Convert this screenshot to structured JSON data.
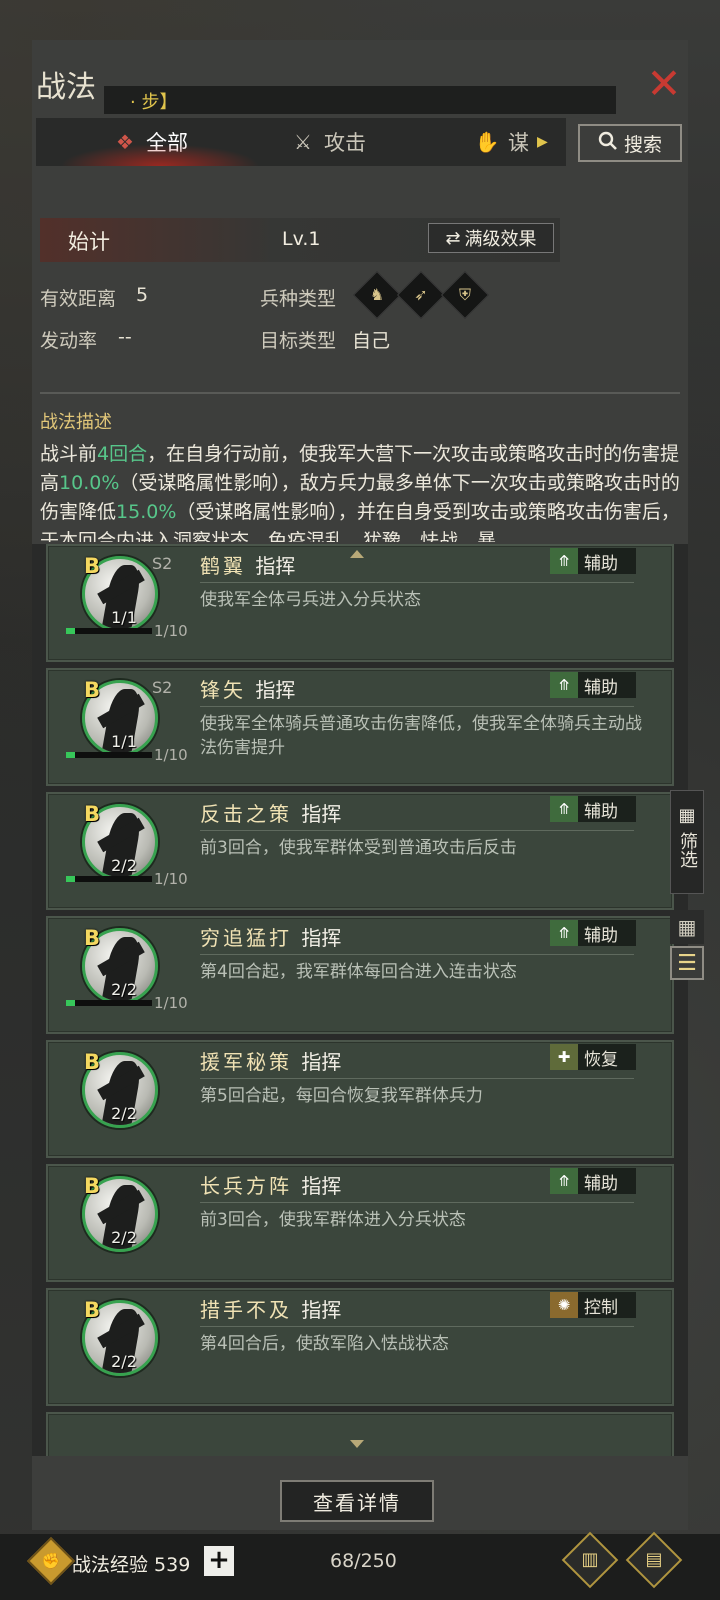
{
  "header": {
    "title": "战法",
    "subtitle": "· 步】",
    "close_icon": "close-icon"
  },
  "tabs": [
    {
      "label": "全部",
      "icon": "bundle-icon",
      "active": true
    },
    {
      "label": "攻击",
      "icon": "crossed-swords-icon",
      "active": false
    },
    {
      "label": "谋",
      "icon": "fan-icon",
      "active": false
    }
  ],
  "search": {
    "label": "搜索"
  },
  "skill": {
    "name": "始计",
    "level": "Lv.1",
    "max_label": "满级效果",
    "range_label": "有效距离",
    "range_value": "5",
    "troop_label": "兵种类型",
    "rate_label": "发动率",
    "rate_value": "--",
    "target_label": "目标类型",
    "target_value": "自己",
    "desc_title": "战法描述",
    "desc": {
      "p1": "战斗前",
      "h1": "4回合",
      "p2": "，在自身行动前，使我军大营下一次攻击或策略攻击时的伤害提高",
      "h2": "10.0%",
      "p3": "（受谋略属性影响），敌方兵力最多单体下一次攻击或策略攻击时的伤害降低",
      "h3": "15.0%",
      "p4": "（受谋略属性影响），并在自身受到攻击或策略攻击伤害后，于本回合内进入",
      "u1": "洞察",
      "p5": "状态，免疫",
      "u2": "混乱",
      "p6": "、",
      "u3": "犹豫",
      "p7": "、",
      "u4": "怯战",
      "p8": "、",
      "u5": "暴"
    }
  },
  "cards": [
    {
      "grade": "B",
      "season": "S2",
      "count": "1/1",
      "progress_text": "1/10",
      "progress": 0.1,
      "name": "鹤翼",
      "type": "指挥",
      "tag": "辅助",
      "tag_icon": "assist-icon",
      "desc": "使我军全体弓兵进入分兵状态"
    },
    {
      "grade": "B",
      "season": "S2",
      "count": "1/1",
      "progress_text": "1/10",
      "progress": 0.1,
      "name": "锋矢",
      "type": "指挥",
      "tag": "辅助",
      "tag_icon": "assist-icon",
      "desc": "使我军全体骑兵普通攻击伤害降低，使我军全体骑兵主动战法伤害提升"
    },
    {
      "grade": "B",
      "season": "",
      "count": "2/2",
      "progress_text": "1/10",
      "progress": 0.1,
      "name": "反击之策",
      "type": "指挥",
      "tag": "辅助",
      "tag_icon": "assist-icon",
      "desc": "前3回合，使我军群体受到普通攻击后反击"
    },
    {
      "grade": "B",
      "season": "",
      "count": "2/2",
      "progress_text": "1/10",
      "progress": 0.1,
      "name": "穷追猛打",
      "type": "指挥",
      "tag": "辅助",
      "tag_icon": "assist-icon",
      "desc": "第4回合起，我军群体每回合进入连击状态"
    },
    {
      "grade": "B",
      "season": "",
      "count": "2/2",
      "progress_text": "",
      "progress": null,
      "name": "援军秘策",
      "type": "指挥",
      "tag": "恢复",
      "tag_icon": "heal-icon",
      "desc": "第5回合起，每回合恢复我军群体兵力"
    },
    {
      "grade": "B",
      "season": "",
      "count": "2/2",
      "progress_text": "",
      "progress": null,
      "name": "长兵方阵",
      "type": "指挥",
      "tag": "辅助",
      "tag_icon": "assist-icon",
      "desc": "前3回合，使我军群体进入分兵状态"
    },
    {
      "grade": "B",
      "season": "",
      "count": "2/2",
      "progress_text": "",
      "progress": null,
      "name": "措手不及",
      "type": "指挥",
      "tag": "控制",
      "tag_icon": "control-icon",
      "desc": "第4回合后，使敌军陷入怯战状态"
    }
  ],
  "side": {
    "filter_label": "筛选"
  },
  "detail_button": "查看详情",
  "footer": {
    "exp_label": "战法经验 539",
    "plus": "+",
    "capacity": "68/250"
  }
}
